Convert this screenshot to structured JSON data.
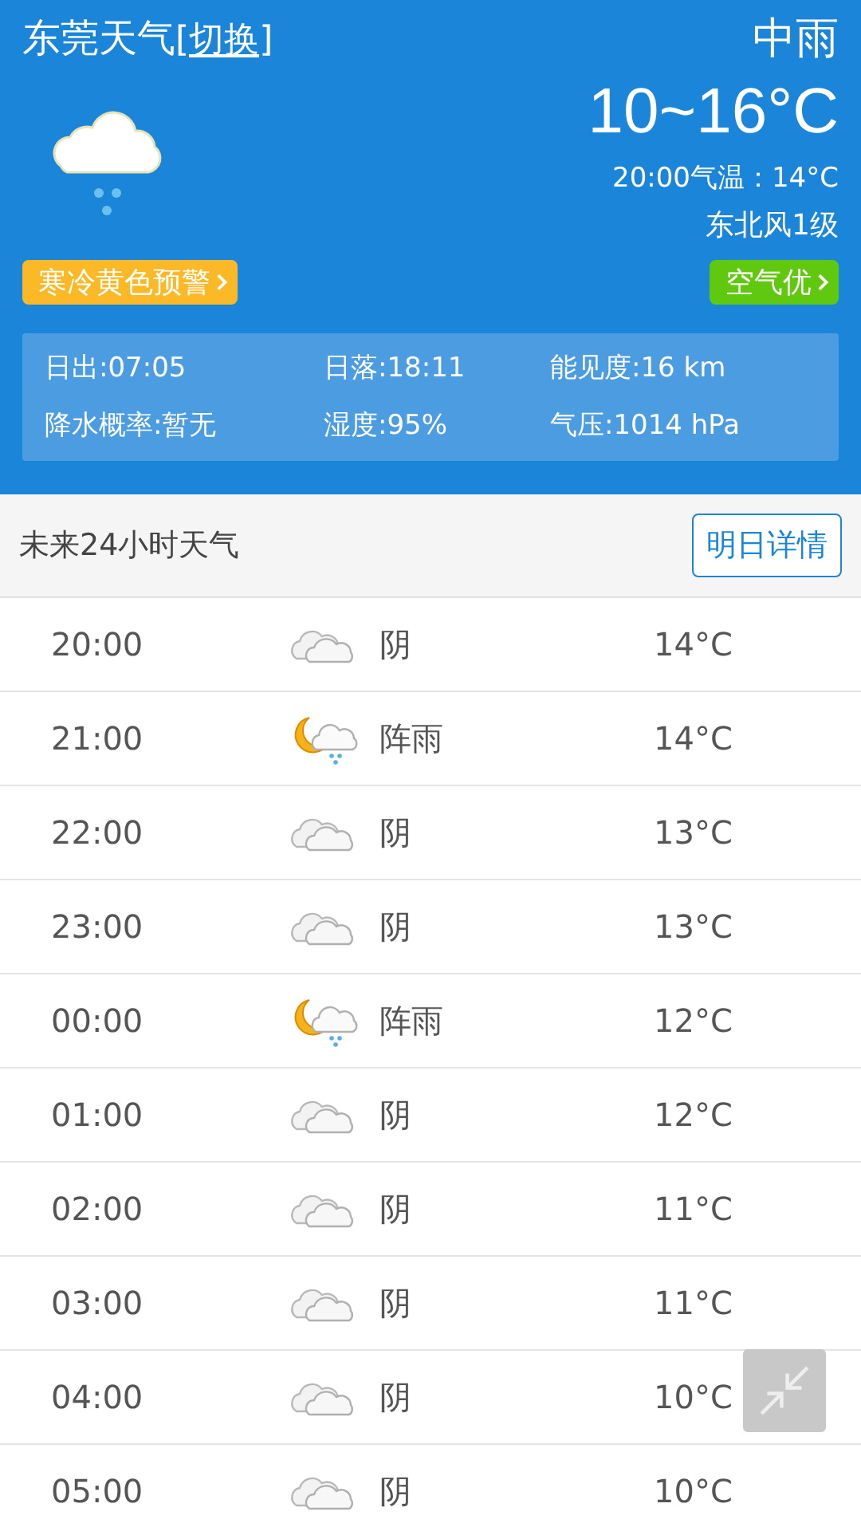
{
  "header": {
    "city": "东莞天气",
    "switch_link": "[切换]",
    "condition": "中雨",
    "temp_range": "10~16°C",
    "current_temp": "20:00气温：14°C",
    "wind": "东北风1级",
    "warning": "寒冷黄色预警",
    "air_quality": "空气优"
  },
  "details": [
    {
      "label": "日出:07:05"
    },
    {
      "label": "日落:18:11"
    },
    {
      "label": "能见度:16 km"
    },
    {
      "label": "降水概率:暂无"
    },
    {
      "label": "湿度:95%"
    },
    {
      "label": "气压:1014 hPa"
    }
  ],
  "hourly": {
    "title": "未来24小时天气",
    "button": "明日详情",
    "rows": [
      {
        "time": "20:00",
        "kind": "cloudy",
        "weather": "阴",
        "temp": "14°C"
      },
      {
        "time": "21:00",
        "kind": "shower_night",
        "weather": "阵雨",
        "temp": "14°C"
      },
      {
        "time": "22:00",
        "kind": "cloudy",
        "weather": "阴",
        "temp": "13°C"
      },
      {
        "time": "23:00",
        "kind": "cloudy",
        "weather": "阴",
        "temp": "13°C"
      },
      {
        "time": "00:00",
        "kind": "shower_night",
        "weather": "阵雨",
        "temp": "12°C"
      },
      {
        "time": "01:00",
        "kind": "cloudy",
        "weather": "阴",
        "temp": "12°C"
      },
      {
        "time": "02:00",
        "kind": "cloudy",
        "weather": "阴",
        "temp": "11°C"
      },
      {
        "time": "03:00",
        "kind": "cloudy",
        "weather": "阴",
        "temp": "11°C"
      },
      {
        "time": "04:00",
        "kind": "cloudy",
        "weather": "阴",
        "temp": "10°C"
      },
      {
        "time": "05:00",
        "kind": "cloudy",
        "weather": "阴",
        "temp": "10°C"
      }
    ]
  }
}
